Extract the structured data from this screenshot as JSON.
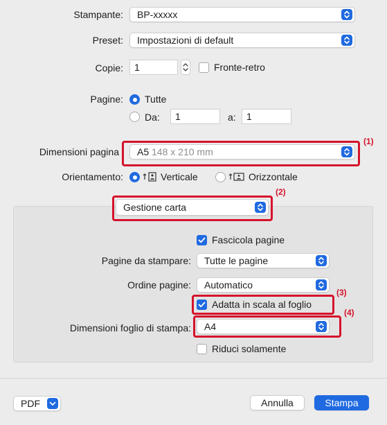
{
  "printer": {
    "label": "Stampante:",
    "value": "BP-xxxxx"
  },
  "preset": {
    "label": "Preset:",
    "value": "Impostazioni di default"
  },
  "copies": {
    "label": "Copie:",
    "value": "1",
    "duplex_label": "Fronte-retro"
  },
  "pages": {
    "label": "Pagine:",
    "all_label": "Tutte",
    "from_label": "Da:",
    "from_value": "1",
    "to_label": "a:",
    "to_value": "1"
  },
  "paper_size": {
    "label": "Dimensioni pagina",
    "value": "A5",
    "detail": "148 x 210 mm"
  },
  "orientation": {
    "label": "Orientamento:",
    "portrait": "Verticale",
    "landscape": "Orizzontale"
  },
  "section": {
    "value": "Gestione carta"
  },
  "collate": {
    "label": "Fascicola pagine",
    "checked": true
  },
  "pages_to_print": {
    "label": "Pagine da stampare:",
    "value": "Tutte le pagine"
  },
  "page_order": {
    "label": "Ordine pagine:",
    "value": "Automatico"
  },
  "scale_to_fit": {
    "label": "Adatta in scala al foglio",
    "checked": true
  },
  "dest_paper": {
    "label": "Dimensioni foglio di stampa:",
    "value": "A4"
  },
  "scale_down_only": {
    "label": "Riduci solamente",
    "checked": false
  },
  "callouts": {
    "c1": "(1)",
    "c2": "(2)",
    "c3": "(3)",
    "c4": "(4)"
  },
  "footer": {
    "pdf": "PDF",
    "cancel": "Annulla",
    "print": "Stampa"
  },
  "colors": {
    "accent": "#1f6ae0",
    "highlight": "#d5122b"
  }
}
